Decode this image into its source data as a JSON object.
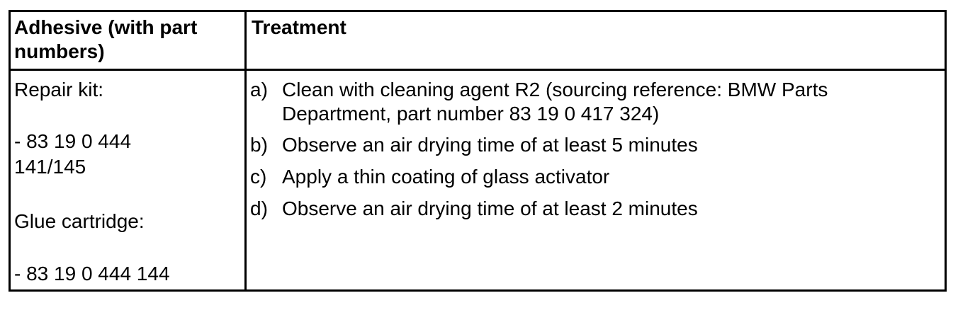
{
  "table": {
    "headers": [
      "Adhesive (with part",
      "numbers)",
      "Treatment"
    ],
    "adhesive": {
      "repair_kit_label": "Repair kit:",
      "repair_kit_line1": "-  83 19 0 444",
      "repair_kit_line2": "141/145",
      "glue_label": "Glue cartridge:",
      "glue_part": "-  83 19 0 444 144"
    },
    "steps": [
      {
        "label": "a)",
        "lines": [
          "Clean with cleaning agent R2 (sourcing reference: BMW Parts",
          "Department, part number 83 19 0 417 324)"
        ]
      },
      {
        "label": "b)",
        "lines": [
          "Observe an air drying time of at least 5 minutes"
        ]
      },
      {
        "label": "c)",
        "lines": [
          "Apply a thin coating of glass activator"
        ]
      },
      {
        "label": "d)",
        "lines": [
          "Observe an air drying time of at least 2 minutes"
        ]
      }
    ]
  }
}
